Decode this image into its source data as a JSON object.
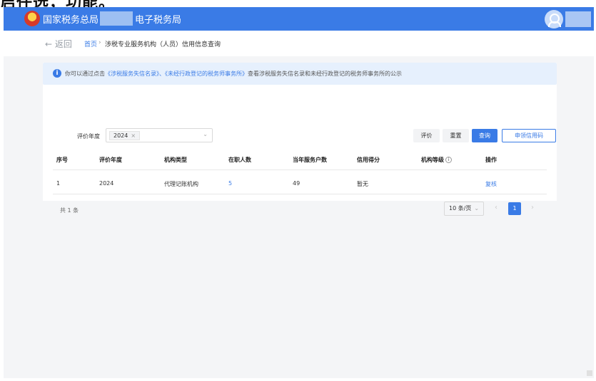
{
  "top_caption": "启任选，功能。",
  "header": {
    "brand": "国家税务总局",
    "sub_brand": "电子税务局"
  },
  "breadcrumb": {
    "back_label": "← 返回",
    "home": "首页",
    "separator": "›",
    "current": "涉税专业服务机构（人员）信用信息查询"
  },
  "notice": {
    "prefix": "你可以通过点击",
    "link1": "《涉税服务失信名录》",
    "mid": "、",
    "link2": "《未经行政登记的税务师事务所》",
    "suffix": "查看涉税服务失信名录和未经行政登记的税务师事务所的公示"
  },
  "filter": {
    "year_label": "评价年度",
    "year_value": "2024",
    "tag_close": "×",
    "chevron": "⌄"
  },
  "buttons": {
    "evaluate": "评价",
    "reset": "重置",
    "query": "查询",
    "apply": "申领信用码"
  },
  "table": {
    "headers": [
      "序号",
      "评价年度",
      "机构类型",
      "在职人数",
      "当年服务户数",
      "信用得分",
      "机构等级",
      "操作"
    ],
    "rows": [
      {
        "index": "1",
        "year": "2024",
        "type": "代理记账机构",
        "staff": "5",
        "clients": "49",
        "score": "暂无",
        "level": "",
        "action": "复核"
      }
    ],
    "level_help": "i"
  },
  "pagination": {
    "total": "共 1 条",
    "page_size": "10 条/页",
    "chevron": "⌄",
    "prev": "‹",
    "current": "1",
    "next": "›"
  }
}
